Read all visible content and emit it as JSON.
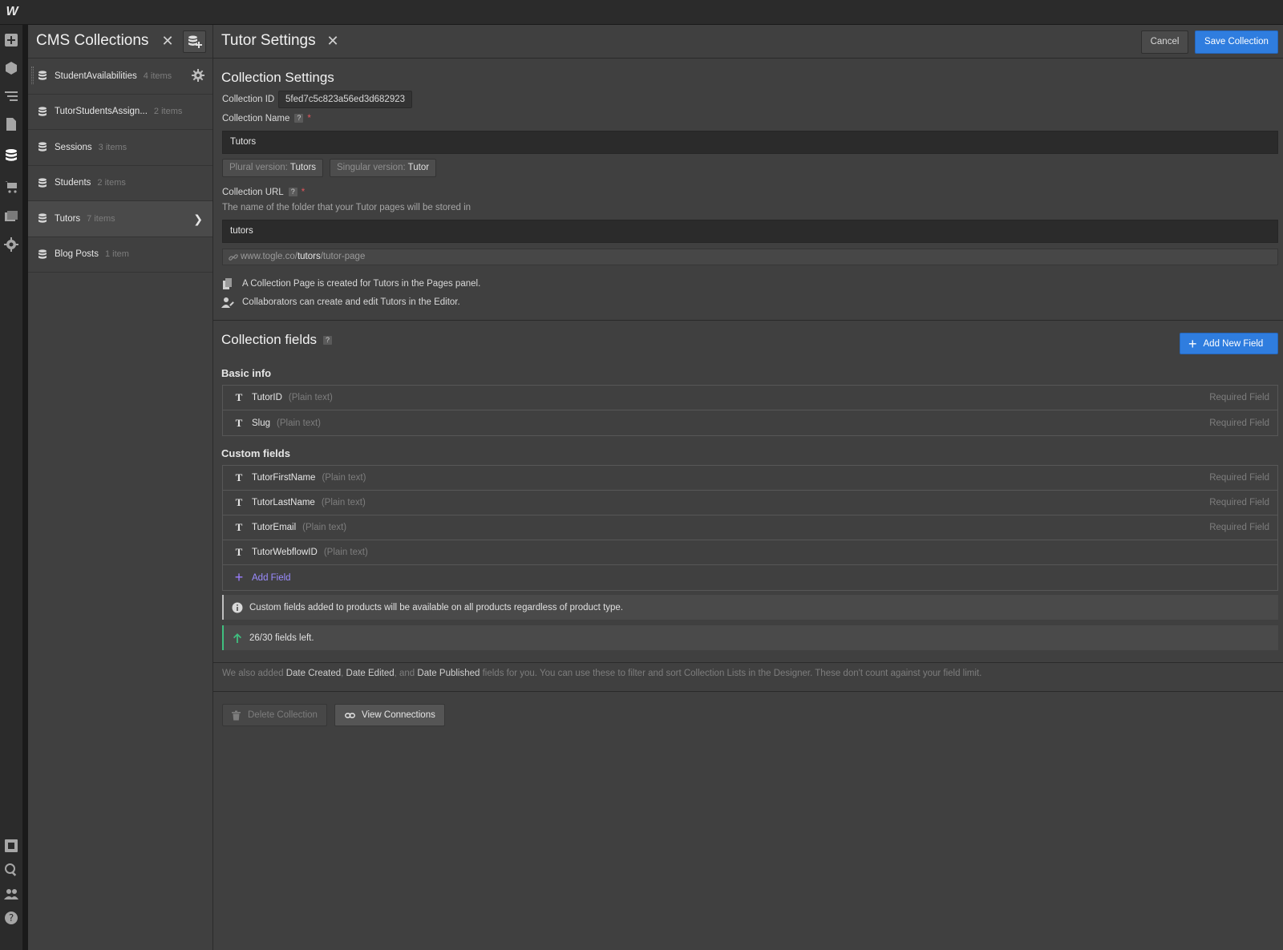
{
  "app": {
    "logo": "W"
  },
  "cms_panel": {
    "title": "CMS Collections",
    "collections": [
      {
        "name": "StudentAvailabilities",
        "count": "4 items"
      },
      {
        "name": "TutorStudentsAssign...",
        "count": "2 items"
      },
      {
        "name": "Sessions",
        "count": "3 items"
      },
      {
        "name": "Students",
        "count": "2 items"
      },
      {
        "name": "Tutors",
        "count": "7 items"
      },
      {
        "name": "Blog Posts",
        "count": "1 item"
      }
    ]
  },
  "settings": {
    "title": "Tutor Settings",
    "cancel_label": "Cancel",
    "save_label": "Save Collection",
    "section_title": "Collection Settings",
    "collection_id_label": "Collection ID",
    "collection_id": "5fed7c5c823a56ed3d682923",
    "collection_name_label": "Collection Name",
    "collection_name": "Tutors",
    "plural_label": "Plural version:",
    "plural_value": "Tutors",
    "singular_label": "Singular version:",
    "singular_value": "Tutor",
    "collection_url_label": "Collection URL",
    "collection_url_help": "The name of the folder that your Tutor pages will be stored in",
    "collection_url": "tutors",
    "url_preview_prefix": "www.togle.co/",
    "url_preview_slug": "tutors",
    "url_preview_suffix": "/tutor-page",
    "info_pages": "A Collection Page is created for Tutors in the Pages panel.",
    "info_collaborators": "Collaborators can create and edit Tutors in the Editor."
  },
  "fields": {
    "title": "Collection fields",
    "add_new_label": "Add New Field",
    "basic_info_title": "Basic info",
    "basic_info": [
      {
        "name": "TutorID",
        "type": "(Plain text)",
        "required": "Required Field"
      },
      {
        "name": "Slug",
        "type": "(Plain text)",
        "required": "Required Field"
      }
    ],
    "custom_title": "Custom fields",
    "custom": [
      {
        "name": "TutorFirstName",
        "type": "(Plain text)",
        "required": "Required Field"
      },
      {
        "name": "TutorLastName",
        "type": "(Plain text)",
        "required": "Required Field"
      },
      {
        "name": "TutorEmail",
        "type": "(Plain text)",
        "required": "Required Field"
      },
      {
        "name": "TutorWebflowID",
        "type": "(Plain text)",
        "required": ""
      }
    ],
    "add_field_label": "Add Field",
    "notice_products": "Custom fields added to products will be available on all products regardless of product type.",
    "notice_fields_left": "26/30 fields left.",
    "footnote_pre": "We also added",
    "footnote_date_created": "Date Created",
    "footnote_date_edited": "Date Edited",
    "footnote_and": ", and",
    "footnote_date_published": "Date Published",
    "footnote_post": "fields for you. You can use these to filter and sort Collection Lists in the Designer. These don't count against your field limit.",
    "delete_label": "Delete Collection",
    "view_connections_label": "View Connections"
  },
  "colors": {
    "accent": "#2f7ddf",
    "success": "#3fbf7f",
    "required": "#e0555c",
    "add_field": "#9b8cff"
  }
}
